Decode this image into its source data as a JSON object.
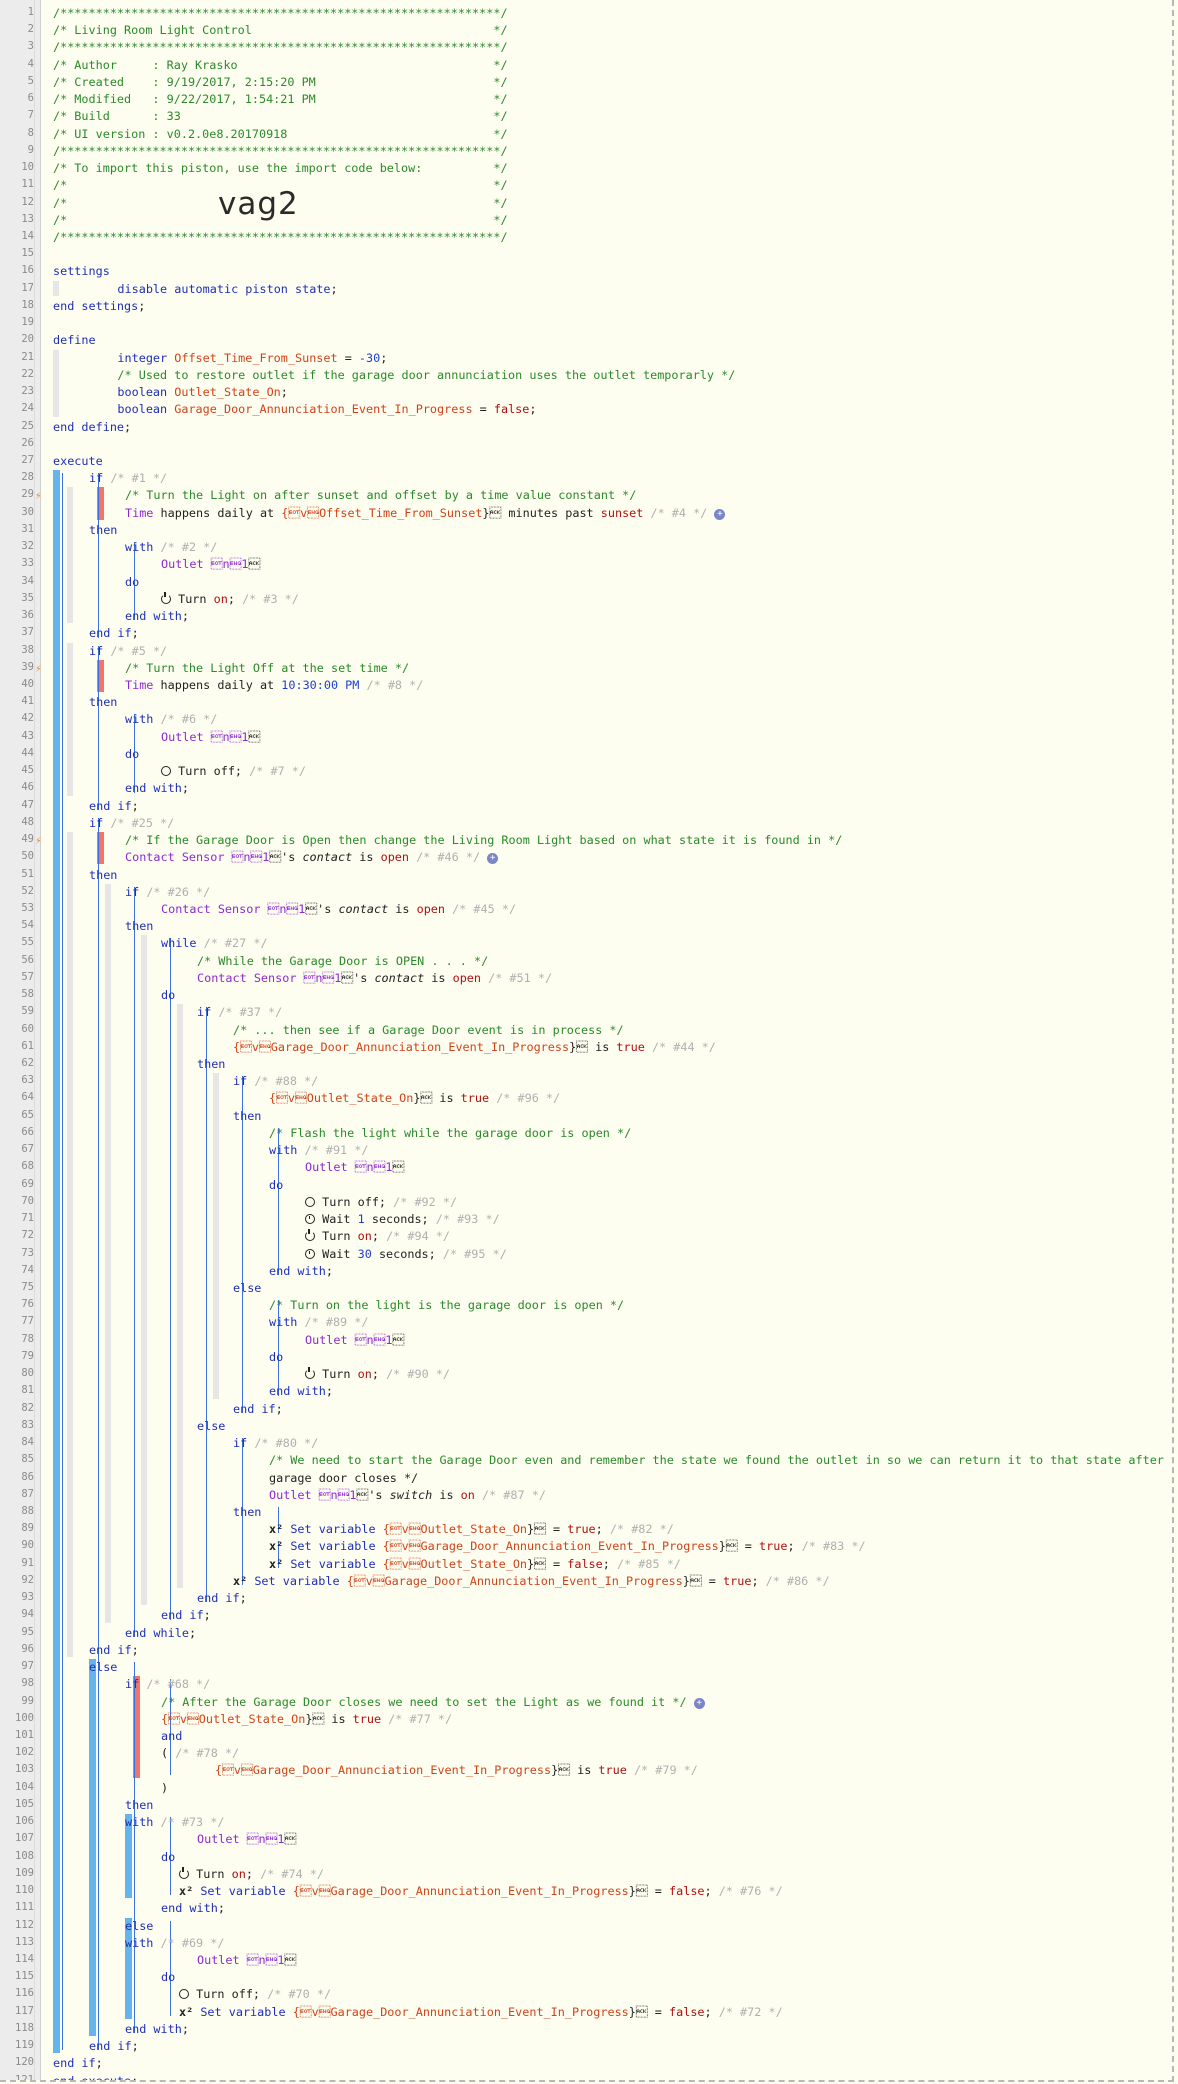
{
  "piston": {
    "name": "Living Room Light Control",
    "author": "Ray Krasko",
    "created": "9/19/2017, 2:15:20 PM",
    "modified": "9/22/2017, 1:54:21 PM",
    "build": "33",
    "ui_version": "v0.2.0e8.20170918",
    "import_code": "vag2"
  },
  "code_lines": [
    "/**************************************************************/",
    "/* Living Room Light Control                                  */",
    "/**************************************************************/",
    "/* Author     : Ray Krasko                                    */",
    "/* Created    : 9/19/2017, 2:15:20 PM                         */",
    "/* Modified   : 9/22/2017, 1:54:21 PM                         */",
    "/* Build      : 33                                            */",
    "/* UI version : v0.2.0e8.20170918                             */",
    "/**************************************************************/",
    "/* To import this piston, use the import code below:          */",
    "/*                                                            */",
    "/*                                                            */",
    "/*                                                            */",
    "/**************************************************************/",
    "",
    "settings",
    "    disable automatic piston state;",
    "end settings;",
    "",
    "define",
    "    integer Offset_Time_From_Sunset = -30;",
    "    /* Used to restore outlet if the garage door annunciation uses the outlet temporarly */",
    "    boolean Outlet_State_On;",
    "    boolean Garage_Door_Annunciation_Event_In_Progress = false;",
    "end define;",
    "",
    "execute",
    "if /* #1 */",
    "/* Turn the Light on after sunset and offset by a time value constant */",
    "Time happens daily at {Offset_Time_From_Sunset} minutes past sunset /* #4 */",
    "then",
    "with /* #2 */",
    "Outlet 1",
    "do",
    "Turn on; /* #3 */",
    "end with;",
    "end if;",
    "if /* #5 */",
    "/* Turn the Light Off at the set time */",
    "Time happens daily at 10:30:00 PM /* #8 */",
    "then",
    "with /* #6 */",
    "Outlet 1",
    "do",
    "Turn off; /* #7 */",
    "end with;",
    "end if;",
    "if /* #25 */",
    "/* If the Garage Door is Open then change the Living Room Light based on what state it is found in */",
    "Contact Sensor 1's contact is open /* #46 */",
    "then",
    "if /* #26 */",
    "Contact Sensor 1's contact is open /* #45 */",
    "then",
    "while /* #27 */",
    "/* While the Garage Door is OPEN . . . */",
    "Contact Sensor 1's contact is open /* #51 */",
    "do",
    "if /* #37 */",
    "/* ... then see if a Garage Door event is in process */",
    "{Garage_Door_Annunciation_Event_In_Progress} is true /* #44 */",
    "then",
    "if /* #88 */",
    "{Outlet_State_On} is true /* #96 */",
    "then",
    "/* Flash the light while the garage door is open */",
    "with /* #91 */",
    "Outlet 1",
    "do",
    "Turn off; /* #92 */",
    "Wait 1 seconds; /* #93 */",
    "Turn on; /* #94 */",
    "Wait 30 seconds; /* #95 */",
    "end with;",
    "else",
    "/* Turn on the light is the garage door is open */",
    "with /* #89 */",
    "Outlet 1",
    "do",
    "Turn on; /* #90 */",
    "end with;",
    "end if;",
    "else",
    "if /* #80 */",
    "/* We need to start the Garage Door even and remember the state we found the outlet in so we can return it to that state after the",
    "garage door closes */",
    "Outlet 1's switch is on /* #87 */",
    "then",
    "Set variable {Outlet_State_On} = true; /* #82 */",
    "Set variable {Garage_Door_Annunciation_Event_In_Progress} = true; /* #83 */",
    "Set variable {Outlet_State_On} = false; /* #85 */",
    "Set variable {Garage_Door_Annunciation_Event_In_Progress} = true; /* #86 */",
    "end if;",
    "end if;",
    "end while;",
    "end if;",
    "else",
    "if /* #68 */",
    "/* After the Garage Door closes we need to set the Light as we found it */",
    "{Outlet_State_On} is true /* #77 */",
    "and",
    "( /* #78 */",
    "{Garage_Door_Annunciation_Event_In_Progress} is true /* #79 */",
    ")",
    "then",
    "with /* #73 */",
    "Outlet 1",
    "do",
    "Turn on; /* #74 */",
    "Set variable {Garage_Door_Annunciation_Event_In_Progress} = false; /* #76 */",
    "end with;",
    "else",
    "with /* #69 */",
    "Outlet 1",
    "do",
    "Turn off; /* #70 */",
    "Set variable {Garage_Door_Annunciation_Event_In_Progress} = false; /* #72 */",
    "end with;",
    "end if;",
    "end if;",
    "end execute;"
  ],
  "icons": {
    "add": "add-icon",
    "power_off": "power-off-icon",
    "power_on": "power-on-icon",
    "wait": "clock-icon",
    "set_variable": "x2-variable-icon",
    "trigger": "lightning-icon"
  },
  "colors": {
    "background": "#fdfdf0",
    "keyword": "#1f2fb8",
    "comment": "#2a8a2a",
    "device": "#8e2ad0",
    "variable": "#d0441a",
    "number": "#1f3fd0",
    "value": "#b01010",
    "block_bar": "#64b4ee",
    "trigger_bar": "#f07468"
  }
}
